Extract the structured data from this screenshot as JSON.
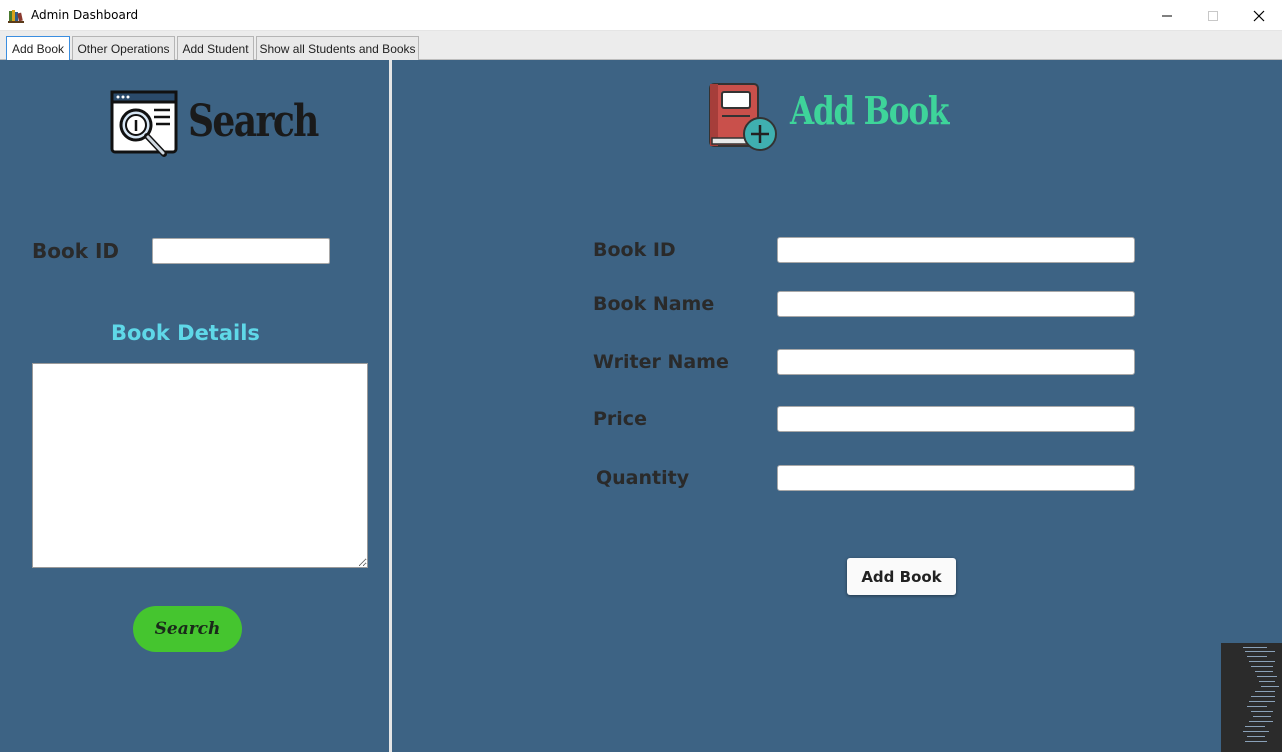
{
  "window": {
    "title": "Admin Dashboard"
  },
  "tabs": [
    {
      "label": "Add Book",
      "active": true
    },
    {
      "label": "Other Operations",
      "active": false
    },
    {
      "label": "Add Student",
      "active": false
    },
    {
      "label": "Show all Students and Books",
      "active": false
    }
  ],
  "search_panel": {
    "title": "Search",
    "book_id_label": "Book ID",
    "book_id_value": "",
    "details_title": "Book Details",
    "details_value": "",
    "search_button": "Search",
    "icon": "magnifier-browser-icon"
  },
  "add_panel": {
    "title": "Add Book",
    "icon": "book-add-icon",
    "fields": [
      {
        "label": "Book ID",
        "value": ""
      },
      {
        "label": "Book Name",
        "value": ""
      },
      {
        "label": "Writer Name",
        "value": ""
      },
      {
        "label": "Price",
        "value": ""
      },
      {
        "label": "Quantity",
        "value": ""
      }
    ],
    "submit_button": "Add Book"
  },
  "colors": {
    "background": "#3d6384",
    "search_button": "#45c52f",
    "details_title": "#5fd8e8",
    "add_title": "#3ed49a"
  }
}
